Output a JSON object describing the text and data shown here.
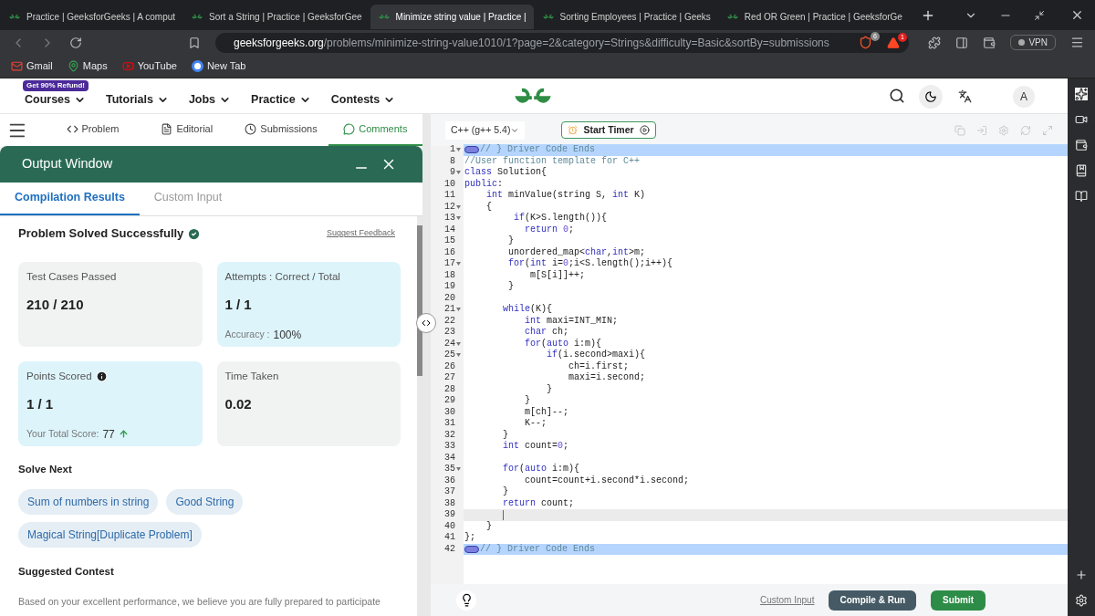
{
  "browser": {
    "tabs": [
      {
        "title": "Practice | GeeksforGeeks | A comput",
        "selected": false
      },
      {
        "title": "Sort a String | Practice | GeeksforGee",
        "selected": false
      },
      {
        "title": "Minimize string value | Practice |",
        "selected": true
      },
      {
        "title": "Sorting Employees | Practice | Geeks",
        "selected": false
      },
      {
        "title": "Red OR Green | Practice | GeeksforGe",
        "selected": false
      }
    ],
    "address": {
      "domain": "geeksforgeeks.org",
      "path": "/problems/minimize-string-value1010/1?page=2&category=Strings&difficulty=Basic&sortBy=submissions"
    },
    "shield_count": "6",
    "alert_count": "1",
    "vpn_label": "VPN",
    "bookmarks": [
      {
        "label": "Gmail",
        "kind": "mail"
      },
      {
        "label": "Maps",
        "kind": "pin"
      },
      {
        "label": "YouTube",
        "kind": "video"
      },
      {
        "label": "New Tab",
        "kind": "google"
      }
    ]
  },
  "site_nav": {
    "badge": "Get 90% Refund!",
    "items": [
      "Courses",
      "Tutorials",
      "Jobs",
      "Practice",
      "Contests"
    ],
    "avatar": "A"
  },
  "problem_tabs": [
    {
      "label": "Problem",
      "kind": "code",
      "selected": false
    },
    {
      "label": "Editorial",
      "kind": "doc",
      "selected": false
    },
    {
      "label": "Submissions",
      "kind": "clock",
      "selected": false
    },
    {
      "label": "Comments",
      "kind": "comment",
      "selected": true
    }
  ],
  "output_window": {
    "title": "Output Window",
    "tabs": [
      {
        "label": "Compilation Results",
        "selected": true
      },
      {
        "label": "Custom Input",
        "selected": false
      }
    ],
    "status": "Problem Solved Successfully",
    "feedback_link": "Suggest Feedback",
    "cards": [
      {
        "label": "Test Cases Passed",
        "value": "210 / 210",
        "highlighted": false
      },
      {
        "label": "Attempts : Correct / Total",
        "value": "1 / 1",
        "sub_label": "Accuracy :",
        "sub_value": "100%",
        "highlighted": true
      },
      {
        "label": "Points Scored",
        "value": "1 / 1",
        "info": true,
        "sub_label": "Your Total Score:",
        "sub_value": "77",
        "rising": true,
        "highlighted": true
      },
      {
        "label": "Time Taken",
        "value": "0.02",
        "highlighted": false
      }
    ],
    "solve_next": {
      "heading": "Solve Next",
      "items": [
        "Sum of numbers in string",
        "Good String",
        "Magical String[Duplicate Problem]"
      ]
    },
    "suggested_contest": {
      "heading": "Suggested Contest",
      "text": "Based on your excellent performance, we believe you are fully prepared to participate"
    }
  },
  "editor": {
    "language": "C++ (g++ 5.4)",
    "timer_label": "Start Timer",
    "lines": [
      {
        "num": "1",
        "kind": "collapsed",
        "fold": true,
        "tokens": [
          {
            "t": "// } Driver Code Ends",
            "kind": "comment"
          }
        ]
      },
      {
        "num": "8",
        "kind": "code",
        "fold": false,
        "tokens": [
          {
            "t": "//User function template for C++",
            "kind": "comment"
          }
        ]
      },
      {
        "num": "9",
        "kind": "code",
        "fold": true,
        "tokens": [
          {
            "t": "class",
            "kind": "keyword"
          },
          {
            "t": " Solution{",
            "kind": "plain"
          }
        ]
      },
      {
        "num": "10",
        "kind": "code",
        "fold": false,
        "tokens": [
          {
            "t": "public",
            "kind": "keyword"
          },
          {
            "t": ":",
            "kind": "plain"
          }
        ]
      },
      {
        "num": "11",
        "kind": "code",
        "fold": false,
        "tokens": [
          {
            "t": "    int",
            "kind": "keyword"
          },
          {
            "t": " minValue(string S, ",
            "kind": "plain"
          },
          {
            "t": "int",
            "kind": "keyword"
          },
          {
            "t": " K)",
            "kind": "plain"
          }
        ]
      },
      {
        "num": "12",
        "kind": "code",
        "fold": true,
        "tokens": [
          {
            "t": "    {",
            "kind": "plain"
          }
        ]
      },
      {
        "num": "13",
        "kind": "code",
        "fold": true,
        "tokens": [
          {
            "t": "         if",
            "kind": "keyword"
          },
          {
            "t": "(K>S.length()){",
            "kind": "plain"
          }
        ]
      },
      {
        "num": "14",
        "kind": "code",
        "fold": false,
        "tokens": [
          {
            "t": "           return",
            "kind": "keyword"
          },
          {
            "t": " 0",
            "kind": "number"
          },
          {
            "t": ";",
            "kind": "plain"
          }
        ]
      },
      {
        "num": "15",
        "kind": "code",
        "fold": false,
        "tokens": [
          {
            "t": "        }",
            "kind": "plain"
          }
        ]
      },
      {
        "num": "16",
        "kind": "code",
        "fold": false,
        "tokens": [
          {
            "t": "        unordered_map<",
            "kind": "plain"
          },
          {
            "t": "char",
            "kind": "keyword"
          },
          {
            "t": ",",
            "kind": "plain"
          },
          {
            "t": "int",
            "kind": "keyword"
          },
          {
            "t": ">m;",
            "kind": "plain"
          }
        ]
      },
      {
        "num": "17",
        "kind": "code",
        "fold": true,
        "tokens": [
          {
            "t": "        for",
            "kind": "keyword"
          },
          {
            "t": "(",
            "kind": "plain"
          },
          {
            "t": "int",
            "kind": "keyword"
          },
          {
            "t": " i=",
            "kind": "plain"
          },
          {
            "t": "0",
            "kind": "number"
          },
          {
            "t": ";i<S.length();i++){",
            "kind": "plain"
          }
        ]
      },
      {
        "num": "18",
        "kind": "code",
        "fold": false,
        "tokens": [
          {
            "t": "            m[S[i]]++;",
            "kind": "plain"
          }
        ]
      },
      {
        "num": "19",
        "kind": "code",
        "fold": false,
        "tokens": [
          {
            "t": "        }",
            "kind": "plain"
          }
        ]
      },
      {
        "num": "20",
        "kind": "code",
        "fold": false
      },
      {
        "num": "21",
        "kind": "code",
        "fold": true,
        "tokens": [
          {
            "t": "       while",
            "kind": "keyword"
          },
          {
            "t": "(K){",
            "kind": "plain"
          }
        ]
      },
      {
        "num": "22",
        "kind": "code",
        "fold": false,
        "tokens": [
          {
            "t": "           int",
            "kind": "keyword"
          },
          {
            "t": " maxi=INT_MIN;",
            "kind": "plain"
          }
        ]
      },
      {
        "num": "23",
        "kind": "code",
        "fold": false,
        "tokens": [
          {
            "t": "           char",
            "kind": "keyword"
          },
          {
            "t": " ch;",
            "kind": "plain"
          }
        ]
      },
      {
        "num": "24",
        "kind": "code",
        "fold": true,
        "tokens": [
          {
            "t": "           for",
            "kind": "keyword"
          },
          {
            "t": "(",
            "kind": "plain"
          },
          {
            "t": "auto",
            "kind": "keyword"
          },
          {
            "t": " i:m){",
            "kind": "plain"
          }
        ]
      },
      {
        "num": "25",
        "kind": "code",
        "fold": true,
        "tokens": [
          {
            "t": "               if",
            "kind": "keyword"
          },
          {
            "t": "(i.second>maxi){",
            "kind": "plain"
          }
        ]
      },
      {
        "num": "26",
        "kind": "code",
        "fold": false,
        "tokens": [
          {
            "t": "                   ch=i.first;",
            "kind": "plain"
          }
        ]
      },
      {
        "num": "27",
        "kind": "code",
        "fold": false,
        "tokens": [
          {
            "t": "                   maxi=i.second;",
            "kind": "plain"
          }
        ]
      },
      {
        "num": "28",
        "kind": "code",
        "fold": false,
        "tokens": [
          {
            "t": "               }",
            "kind": "plain"
          }
        ]
      },
      {
        "num": "29",
        "kind": "code",
        "fold": false,
        "tokens": [
          {
            "t": "           }",
            "kind": "plain"
          }
        ]
      },
      {
        "num": "30",
        "kind": "code",
        "fold": false,
        "tokens": [
          {
            "t": "           m[ch]--;",
            "kind": "plain"
          }
        ]
      },
      {
        "num": "31",
        "kind": "code",
        "fold": false,
        "tokens": [
          {
            "t": "           K--;",
            "kind": "plain"
          }
        ]
      },
      {
        "num": "32",
        "kind": "code",
        "fold": false,
        "tokens": [
          {
            "t": "       }",
            "kind": "plain"
          }
        ]
      },
      {
        "num": "33",
        "kind": "code",
        "fold": false,
        "tokens": [
          {
            "t": "       int",
            "kind": "keyword"
          },
          {
            "t": " count=",
            "kind": "plain"
          },
          {
            "t": "0",
            "kind": "number"
          },
          {
            "t": ";",
            "kind": "plain"
          }
        ]
      },
      {
        "num": "34",
        "kind": "code",
        "fold": false
      },
      {
        "num": "35",
        "kind": "code",
        "fold": true,
        "tokens": [
          {
            "t": "       for",
            "kind": "keyword"
          },
          {
            "t": "(",
            "kind": "plain"
          },
          {
            "t": "auto",
            "kind": "keyword"
          },
          {
            "t": " i:m){",
            "kind": "plain"
          }
        ]
      },
      {
        "num": "36",
        "kind": "code",
        "fold": false,
        "tokens": [
          {
            "t": "           count=count+i.second*i.second;",
            "kind": "plain"
          }
        ]
      },
      {
        "num": "37",
        "kind": "code",
        "fold": false,
        "tokens": [
          {
            "t": "       }",
            "kind": "plain"
          }
        ]
      },
      {
        "num": "38",
        "kind": "code",
        "fold": false,
        "tokens": [
          {
            "t": "       return",
            "kind": "keyword"
          },
          {
            "t": " count;",
            "kind": "plain"
          }
        ]
      },
      {
        "num": "39",
        "kind": "cursor",
        "fold": false
      },
      {
        "num": "40",
        "kind": "code",
        "fold": false,
        "tokens": [
          {
            "t": "    }",
            "kind": "plain"
          }
        ]
      },
      {
        "num": "41",
        "kind": "code",
        "fold": false,
        "tokens": [
          {
            "t": "};",
            "kind": "plain"
          }
        ]
      },
      {
        "num": "42",
        "kind": "collapsed",
        "fold": false,
        "tokens": [
          {
            "t": "// } Driver Code Ends",
            "kind": "comment"
          }
        ]
      }
    ],
    "custom_input": "Custom Input",
    "compile_label": "Compile & Run",
    "submit_label": "Submit"
  }
}
